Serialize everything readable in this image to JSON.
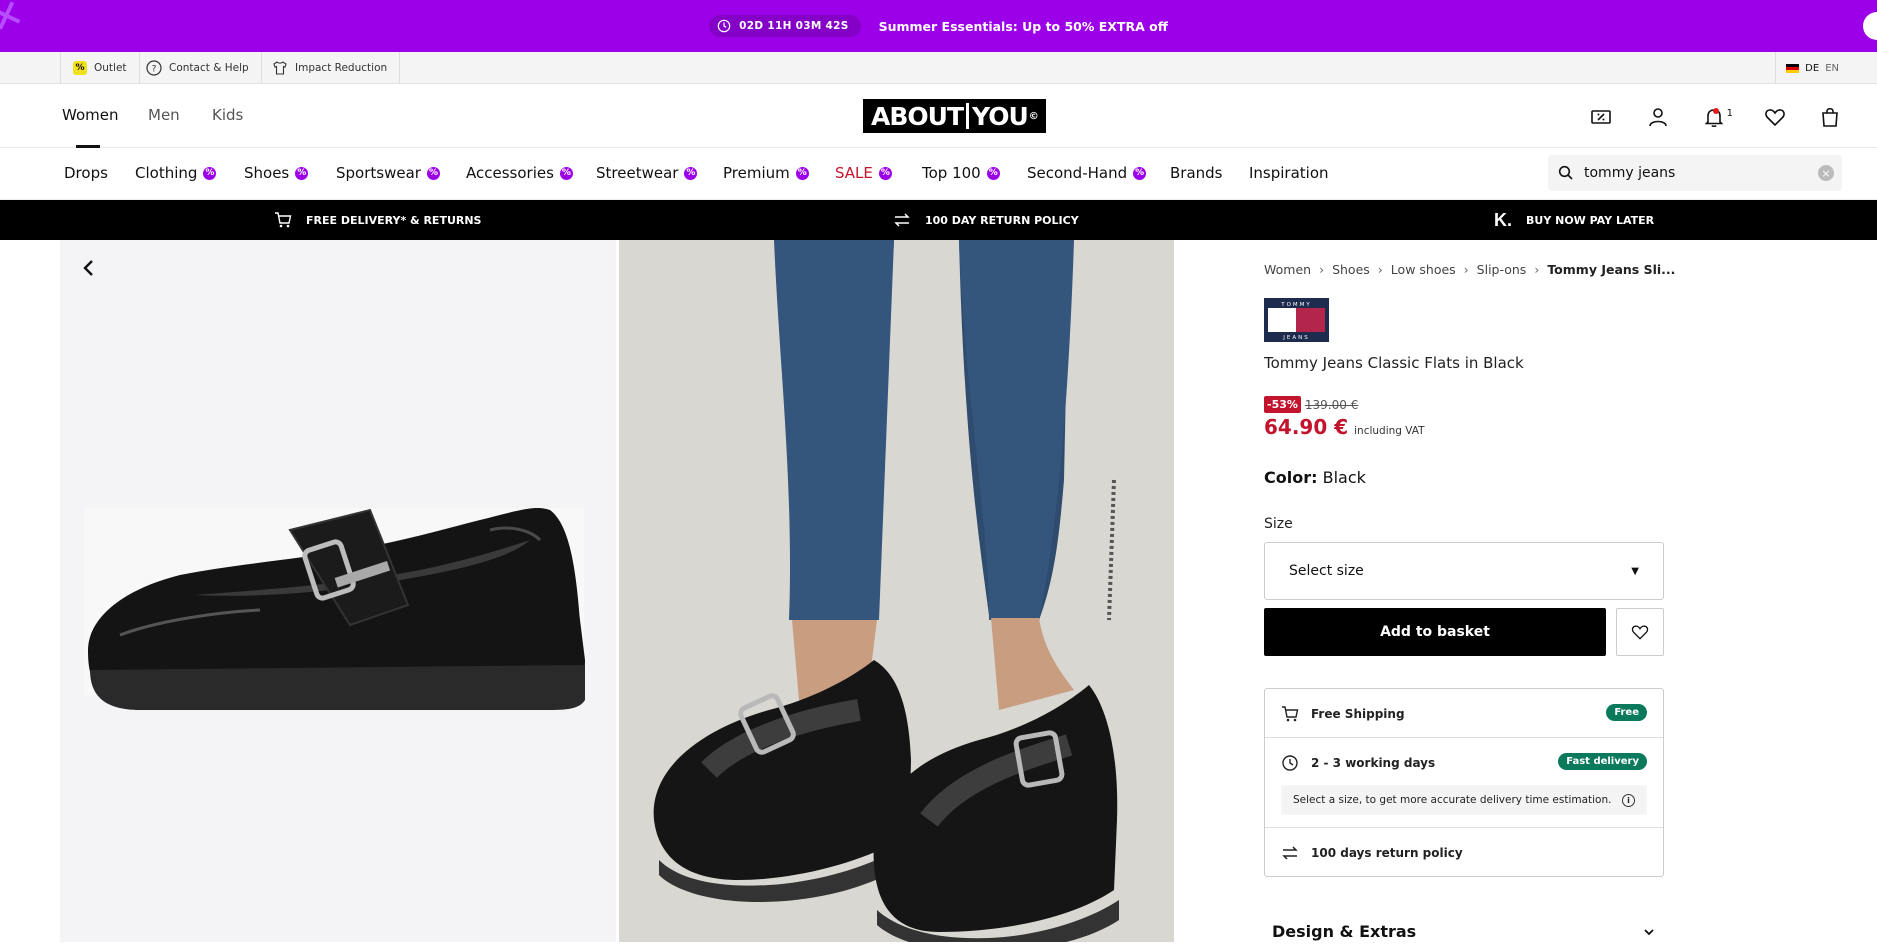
{
  "promo": {
    "timer": "02D 11H 03M 42S",
    "text": "Summer Essentials: Up to 50% EXTRA off"
  },
  "utility": {
    "outlet": "Outlet",
    "contact": "Contact & Help",
    "impact": "Impact Reduction",
    "lang_de": "DE",
    "lang_en": "EN",
    "pct_symbol": "%"
  },
  "header": {
    "genders": [
      "Women",
      "Men",
      "Kids"
    ],
    "logo_left": "ABOUT",
    "logo_right": "YOU",
    "logo_mark": "©",
    "notifications_count": "1"
  },
  "categories": [
    "Drops",
    "Clothing",
    "Shoes",
    "Sportswear",
    "Accessories",
    "Streetwear",
    "Premium",
    "SALE",
    "Top 100",
    "Second-Hand",
    "Brands",
    "Inspiration"
  ],
  "category_badge": "%",
  "search": {
    "value": "tommy jeans",
    "clear": "×"
  },
  "usp": {
    "delivery": "FREE DELIVERY* & RETURNS",
    "returns": "100 DAY RETURN POLICY",
    "klarna_mark": "K.",
    "bnpl": "BUY NOW PAY LATER"
  },
  "breadcrumb": [
    "Women",
    "Shoes",
    "Low shoes",
    "Slip-ons",
    "Tommy Jeans Sli..."
  ],
  "breadcrumb_sep": "›",
  "brand_logo_text": {
    "top": "TOMMY",
    "bottom": "JEANS"
  },
  "product": {
    "name": "Tommy Jeans Classic Flats in Black",
    "discount": "-53%",
    "old_price": "139.00 €",
    "price": "64.90 €",
    "vat": "including VAT",
    "color_label": "Color:",
    "color_value": "Black",
    "size_label": "Size",
    "size_placeholder": "Select size",
    "size_arrow": "▼",
    "add_to_basket": "Add to basket"
  },
  "delivery": {
    "shipping": "Free Shipping",
    "shipping_tag": "Free",
    "days": "2 - 3 working days",
    "days_tag": "Fast delivery",
    "info": "Select a size, to get more accurate delivery time estimation.",
    "info_icon": "i",
    "returns": "100 days return policy"
  },
  "design_extras": "Design & Extras",
  "colors": {
    "promo": "#9b00e8",
    "sale": "#c3142d",
    "tag": "#0b7a5c"
  }
}
